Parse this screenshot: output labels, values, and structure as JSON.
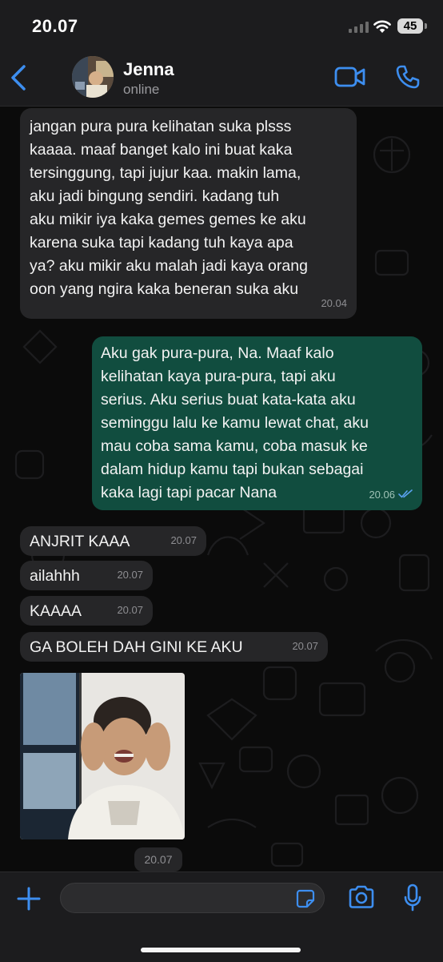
{
  "status_bar": {
    "time": "20.07",
    "battery": "45"
  },
  "header": {
    "contact_name": "Jenna",
    "contact_status": "online",
    "back_icon": "chevron-left-icon",
    "video_icon": "video-camera-icon",
    "call_icon": "phone-icon",
    "accent": "#3d8ef0"
  },
  "messages": [
    {
      "direction": "incoming",
      "text": "jangan pura pura kelihatan suka plsss\nkaaaa. maaf banget kalo ini buat kaka\ntersinggung, tapi jujur kaa. makin lama,\naku jadi bingung sendiri. kadang tuh\naku mikir iya kaka gemes gemes ke aku\nkarena suka tapi kadang tuh kaya apa\nya? aku mikir aku malah jadi kaya orang\noon yang ngira kaka beneran suka aku",
      "time": "20.04"
    },
    {
      "direction": "outgoing",
      "text": "Aku gak pura-pura, Na. Maaf kalo\nkelihatan kaya pura-pura, tapi aku\nserius. Aku serius buat kata-kata aku\nseminggu lalu ke kamu lewat chat, aku\nmau coba sama kamu, coba masuk ke\ndalam hidup kamu tapi bukan sebagai\nkaka lagi tapi pacar Nana",
      "time": "20.06",
      "read_icon": "double-check-icon"
    },
    {
      "direction": "incoming",
      "text": "ANJRIT KAAA",
      "time": "20.07"
    },
    {
      "direction": "incoming",
      "text": "ailahhh",
      "time": "20.07"
    },
    {
      "direction": "incoming",
      "text": "KAAAA",
      "time": "20.07"
    },
    {
      "direction": "incoming",
      "text": "GA BOLEH DAH GINI KE AKU",
      "time": "20.07"
    },
    {
      "direction": "incoming",
      "type": "image",
      "time": "20.07"
    }
  ],
  "composer": {
    "placeholder": "",
    "plus_icon": "plus-icon",
    "sticker_icon": "sticker-icon",
    "camera_icon": "camera-icon",
    "mic_icon": "microphone-icon"
  },
  "colors": {
    "incoming_bubble": "#262628",
    "outgoing_bubble": "#114d3f",
    "read_ticks": "#5aa2f0",
    "background": "#0b0b0b"
  }
}
